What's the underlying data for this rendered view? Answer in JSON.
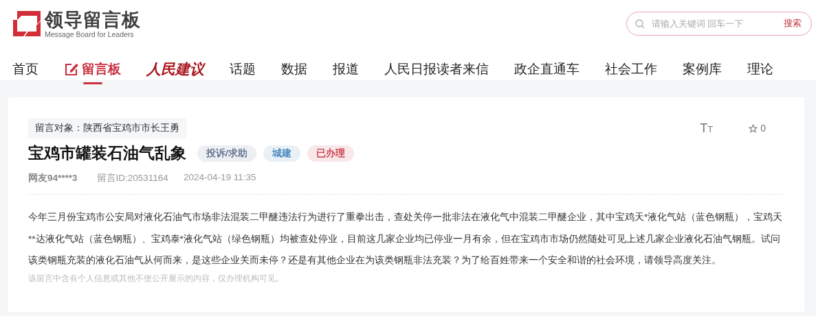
{
  "header": {
    "logo_title": "领导留言板",
    "logo_subtitle": "Message Board for Leaders",
    "search": {
      "placeholder": "请输入关键词 回车一下",
      "button": "搜索"
    }
  },
  "nav": [
    {
      "label": "首页",
      "kind": "text",
      "selected": false
    },
    {
      "label": "留言板",
      "kind": "icon",
      "selected": true
    },
    {
      "label": "人民建议",
      "kind": "brand",
      "selected": false
    },
    {
      "label": "话题",
      "kind": "text",
      "selected": false
    },
    {
      "label": "数据",
      "kind": "text",
      "selected": false
    },
    {
      "label": "报道",
      "kind": "text",
      "selected": false
    },
    {
      "label": "人民日报读者来信",
      "kind": "text",
      "selected": false
    },
    {
      "label": "政企直通车",
      "kind": "text",
      "selected": false
    },
    {
      "label": "社会工作",
      "kind": "text",
      "selected": false
    },
    {
      "label": "案例库",
      "kind": "text",
      "selected": false
    },
    {
      "label": "理论",
      "kind": "text",
      "selected": false
    }
  ],
  "message": {
    "recipient": "留言对象：陕西省宝鸡市市长王勇",
    "font_size_button": "TT",
    "favorite_count": "0",
    "title": "宝鸡市罐装石油气乱象",
    "tags": [
      {
        "label": "投诉/求助",
        "color": "#5b6b8a"
      },
      {
        "label": "城建",
        "color": "#3a7fb8"
      },
      {
        "label": "已办理",
        "color": "#c8303f"
      }
    ],
    "author": "网友94****3",
    "message_id": "留言ID:20531164",
    "time": "2024-04-19 11:35",
    "body": "今年三月份宝鸡市公安局对液化石油气市场非法混装二甲醚违法行为进行了重拳出击，查处关停一批非法在液化气中混装二甲醚企业，其中宝鸡天*液化气站（蓝色钢瓶），宝鸡天**达液化气站（蓝色钢瓶）、宝鸡泰*液化气站（绿色钢瓶）均被查处停业，目前这几家企业均已停业一月有余，但在宝鸡市市场仍然随处可见上述几家企业液化石油气钢瓶。试问该类钢瓶充装的液化石油气从何而来，是这些企业关而未停？还是有其他企业在为该类钢瓶非法充装？为了给百姓带来一个安全和谐的社会环境，请领导高度关注。",
    "privacy_note": "该留言中含有个人信息或其他不便公开展示的内容，仅办理机构可见。"
  }
}
